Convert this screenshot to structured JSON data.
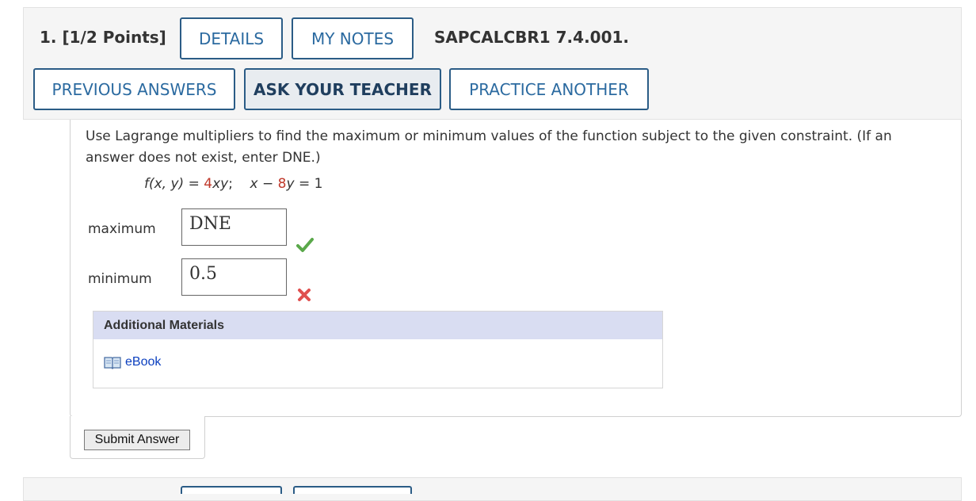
{
  "question": {
    "number_points": "1.  [1/2 Points]",
    "code": "SAPCALCBR1 7.4.001."
  },
  "buttons": {
    "details": "DETAILS",
    "my_notes": "MY NOTES",
    "previous_answers": "PREVIOUS ANSWERS",
    "ask_teacher": "ASK YOUR TEACHER",
    "practice_another": "PRACTICE ANOTHER"
  },
  "prompt": "Use Lagrange multipliers to find the maximum or minimum values of the function subject to the given constraint. (If an answer does not exist, enter DNE.)",
  "equation": {
    "lhs": "f(x, y)",
    "eq1": " = ",
    "coef1": "4",
    "vars1": "xy",
    "sep": ";    ",
    "x": "x",
    "minus": " − ",
    "coef2": "8",
    "y": "y",
    "rhs": " = 1"
  },
  "answers": {
    "maximum_label": "maximum",
    "maximum_value": "DNE",
    "maximum_status": "correct",
    "minimum_label": "minimum",
    "minimum_value": "0.5",
    "minimum_status": "incorrect"
  },
  "materials": {
    "title": "Additional Materials",
    "ebook": "eBook"
  },
  "submit_label": "Submit Answer",
  "icons": {
    "correct": "check-icon",
    "incorrect": "x-icon",
    "ebook": "book-icon"
  },
  "colors": {
    "button_border": "#2b5c86",
    "button_text": "#2b6aa0",
    "correct": "#5aa84a",
    "incorrect": "#e0504f",
    "highlight": "#c0392b",
    "materials_header": "#d9ddf2"
  }
}
